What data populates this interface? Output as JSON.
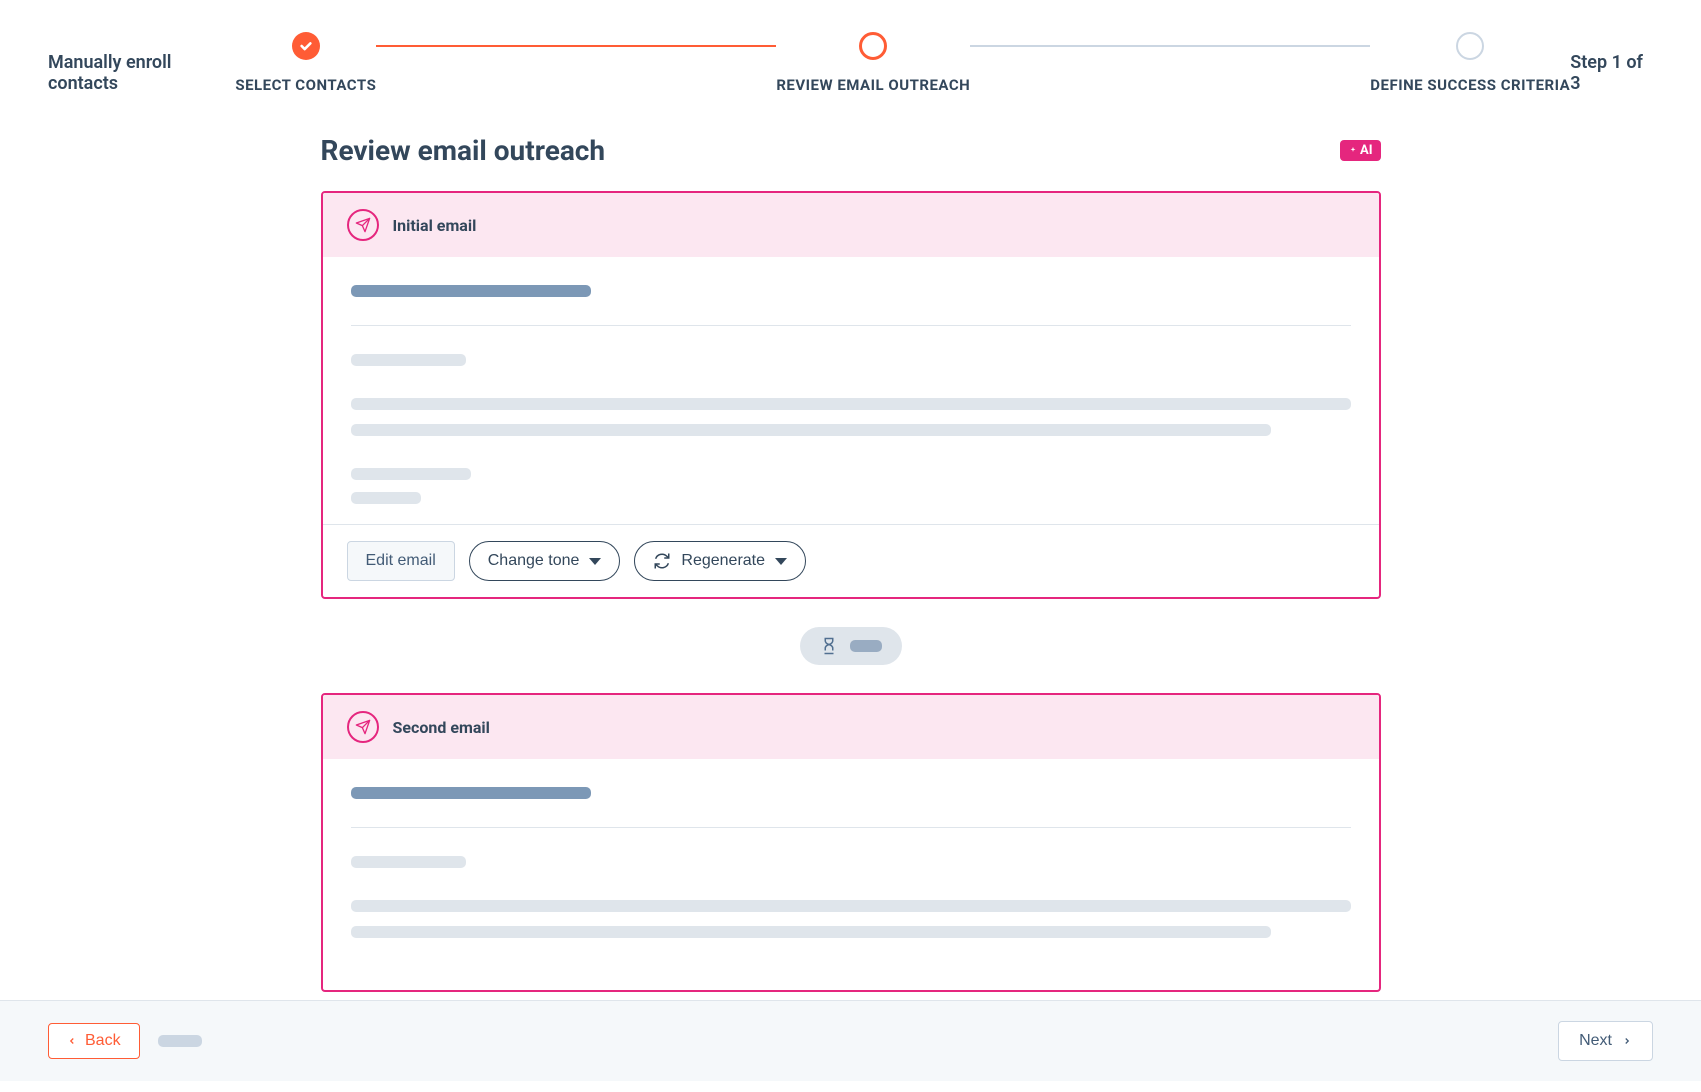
{
  "header": {
    "left_title": "Manually enroll contacts",
    "step_counter": "Step 1 of 3",
    "steps": [
      {
        "label": "SELECT CONTACTS",
        "state": "done"
      },
      {
        "label": "REVIEW EMAIL OUTREACH",
        "state": "current"
      },
      {
        "label": "DEFINE SUCCESS CRITERIA",
        "state": "todo"
      }
    ]
  },
  "page": {
    "title": "Review email outreach",
    "ai_badge": "AI"
  },
  "emails": [
    {
      "title": "Initial email"
    },
    {
      "title": "Second email"
    }
  ],
  "actions": {
    "edit": "Edit email",
    "change_tone": "Change tone",
    "regenerate": "Regenerate"
  },
  "footer": {
    "back": "Back",
    "next": "Next"
  }
}
